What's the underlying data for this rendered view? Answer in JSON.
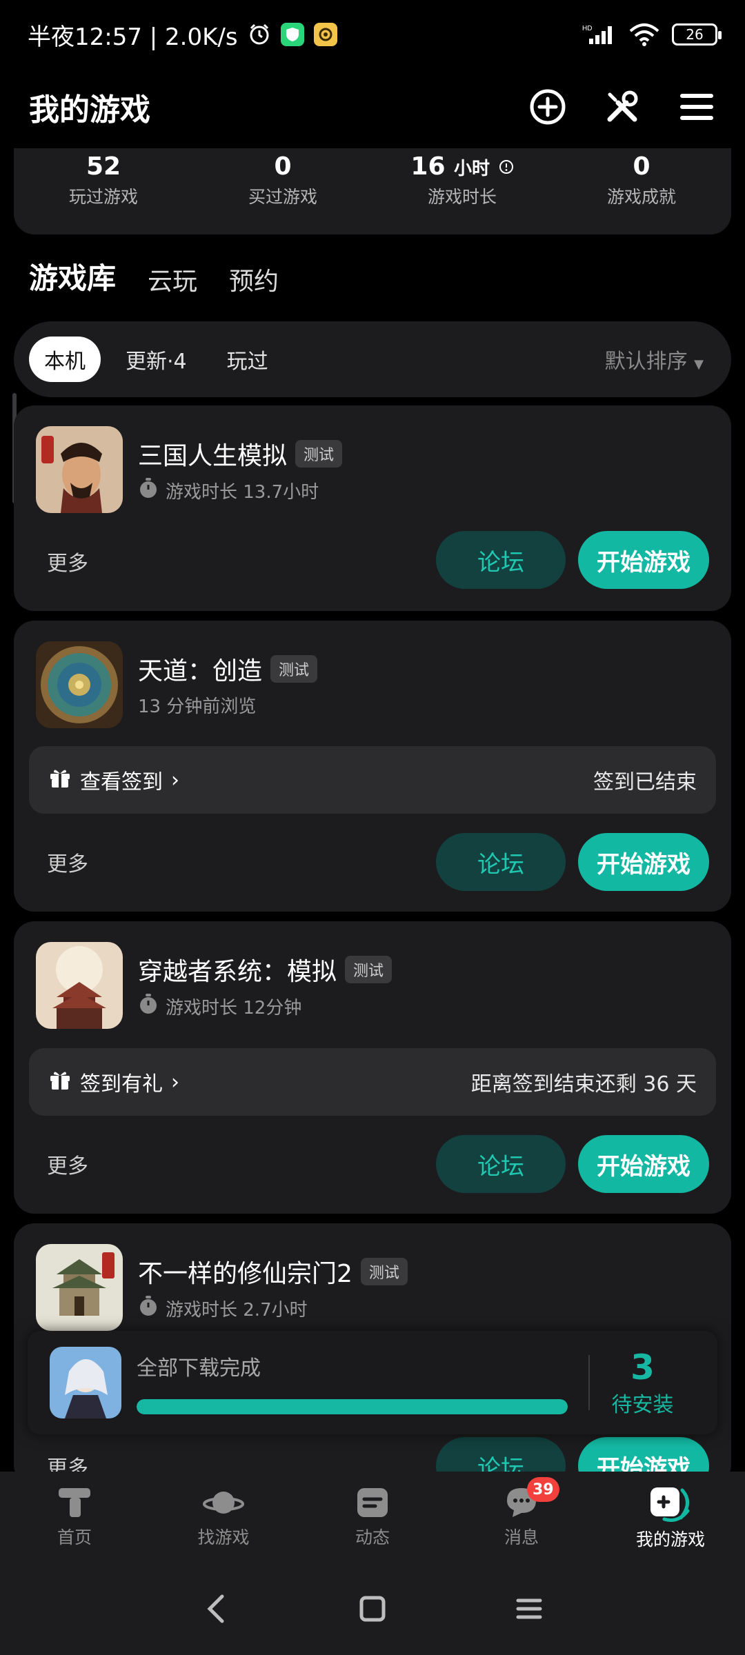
{
  "status_bar": {
    "time": "半夜12:57 | 2.0K/s",
    "signal": "HD",
    "battery": "26",
    "icons": [
      "alarm-icon",
      "shield-app-icon",
      "camera-app-icon",
      "signal-icon",
      "wifi-icon",
      "battery-icon"
    ]
  },
  "header": {
    "title": "我的游戏",
    "icons": [
      "add-circle-icon",
      "tools-icon",
      "menu-icon"
    ]
  },
  "stats": [
    {
      "value": "52",
      "unit": "",
      "label": "玩过游戏"
    },
    {
      "value": "0",
      "unit": "",
      "label": "买过游戏"
    },
    {
      "value": "16",
      "unit": "小时",
      "label": "游戏时长"
    },
    {
      "value": "0",
      "unit": "",
      "label": "游戏成就"
    }
  ],
  "tabs": [
    "游戏库",
    "云玩",
    "预约"
  ],
  "filters": {
    "chips": [
      "本机",
      "更新·4",
      "玩过"
    ],
    "sort": "默认排序"
  },
  "games": [
    {
      "name": "三国人生模拟",
      "tag": "测试",
      "meta": "游戏时长 13.7小时",
      "more": "更多",
      "forum": "论坛",
      "play": "开始游戏"
    },
    {
      "name": "天道：创造",
      "tag": "测试",
      "meta": "13 分钟前浏览",
      "sign_left": "查看签到",
      "sign_right": "签到已结束",
      "more": "更多",
      "forum": "论坛",
      "play": "开始游戏"
    },
    {
      "name": "穿越者系统：模拟",
      "tag": "测试",
      "meta": "游戏时长 12分钟",
      "sign_left": "签到有礼",
      "sign_right": "距离签到结束还剩 36 天",
      "more": "更多",
      "forum": "论坛",
      "play": "开始游戏"
    },
    {
      "name": "不一样的修仙宗门2",
      "tag": "测试",
      "meta": "游戏时长 2.7小时",
      "more": "更多",
      "forum": "论坛",
      "play": "开始游戏"
    }
  ],
  "download": {
    "text": "全部下载完成",
    "progress": 1.0,
    "count": "3",
    "count_label": "待安装"
  },
  "bottom_nav": [
    {
      "label": "首页",
      "icon": "home-icon"
    },
    {
      "label": "找游戏",
      "icon": "planet-icon"
    },
    {
      "label": "动态",
      "icon": "feed-icon"
    },
    {
      "label": "消息",
      "icon": "chat-icon",
      "badge": "39"
    },
    {
      "label": "我的游戏",
      "icon": "gamepad-icon",
      "active": true
    }
  ],
  "colors": {
    "accent": "#13b8a3",
    "forum_bg": "#12413f",
    "card_bg": "#1c1c1e",
    "badge": "#f2413d"
  }
}
